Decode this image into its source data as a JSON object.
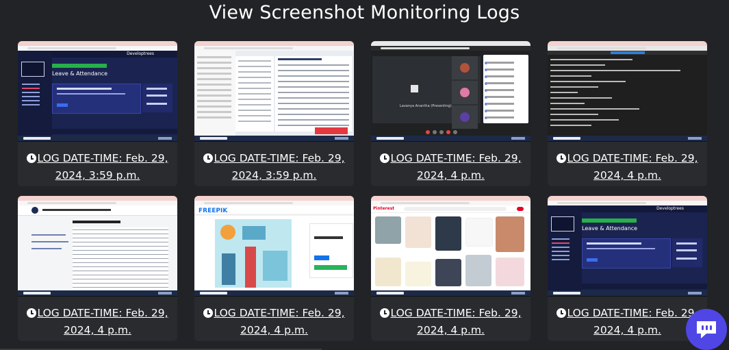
{
  "page": {
    "title": "View Screenshot Monitoring Logs"
  },
  "logs": [
    {
      "label": "LOG DATE-TIME: Feb. 29, 2024, 3:59 p.m.",
      "thumbnail": "leave-attendance-dashboard",
      "thumb_text": {
        "topbar": "Developtrees",
        "heading": "Leave & Attendance"
      }
    },
    {
      "label": "LOG DATE-TIME: Feb. 29, 2024, 3:59 p.m.",
      "thumbnail": "document-editor"
    },
    {
      "label": "LOG DATE-TIME: Feb. 29, 2024, 4 p.m.",
      "thumbnail": "video-meeting",
      "thumb_text": {
        "presenter": "Lavanya Anantha (Presenting)"
      }
    },
    {
      "label": "LOG DATE-TIME: Feb. 29, 2024, 4 p.m.",
      "thumbnail": "terminal"
    },
    {
      "label": "LOG DATE-TIME: Feb. 29, 2024, 4 p.m.",
      "thumbnail": "policy-document"
    },
    {
      "label": "LOG DATE-TIME: Feb. 29, 2024, 4 p.m.",
      "thumbnail": "freepik-page",
      "thumb_text": {
        "logo": "FREEPIK"
      }
    },
    {
      "label": "LOG DATE-TIME: Feb. 29, 2024, 4 p.m.",
      "thumbnail": "pinterest-page",
      "thumb_text": {
        "logo": "Pinterest"
      }
    },
    {
      "label": "LOG DATE-TIME: Feb. 29, 2024, 4 p.m.",
      "thumbnail": "leave-attendance-dashboard",
      "thumb_text": {
        "topbar": "Developtrees",
        "heading": "Leave & Attendance"
      }
    }
  ],
  "icons": {
    "log_icon": "clock-icon",
    "chat_icon": "chat-bubble-icon"
  },
  "colors": {
    "background": "#222326",
    "card": "#2a2b2f",
    "chat_button": "#4f46e5"
  }
}
